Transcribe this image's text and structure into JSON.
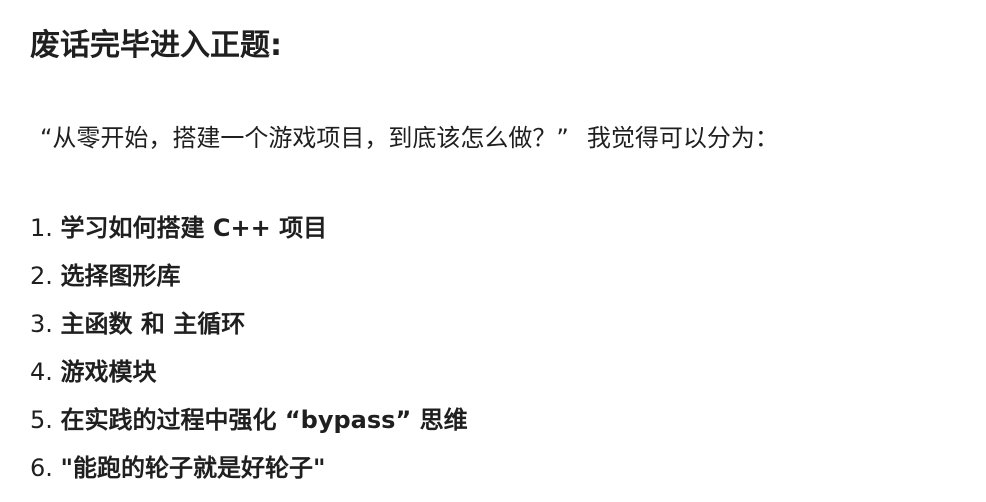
{
  "heading": "废话完毕进入正题:",
  "intro": {
    "question": "“从零开始，搭建一个游戏项目，到底该怎么做？”",
    "answer": "我觉得可以分为："
  },
  "steps": [
    {
      "number": "1.",
      "text": "学习如何搭建 C++ 项目"
    },
    {
      "number": "2.",
      "text": "选择图形库"
    },
    {
      "number": "3.",
      "text": "主函数 和 主循环"
    },
    {
      "number": "4.",
      "text": "游戏模块"
    },
    {
      "number": "5.",
      "text": "在实践的过程中强化 “bypass” 思维"
    },
    {
      "number": "6.",
      "text": "\"能跑的轮子就是好轮子\""
    }
  ]
}
